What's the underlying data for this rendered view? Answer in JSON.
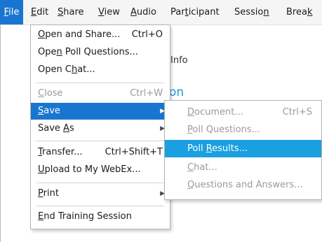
{
  "menubar": {
    "items": [
      {
        "label": "File",
        "mnemonic": "F",
        "rest": "ile",
        "active": true
      },
      {
        "label": "Edit",
        "mnemonic": "E",
        "rest": "dit"
      },
      {
        "label": "Share",
        "mnemonic": "S",
        "rest": "hare"
      },
      {
        "label": "View",
        "mnemonic": "V",
        "rest": "iew"
      },
      {
        "label": "Audio",
        "mnemonic": "A",
        "rest": "udio"
      },
      {
        "label": "Participant",
        "pre": "Par",
        "mnemonic": "t",
        "rest": "icipant"
      },
      {
        "label": "Session",
        "pre": "Sessio",
        "mnemonic": "n",
        "rest": ""
      },
      {
        "label": "Break",
        "pre": "Brea",
        "mnemonic": "k",
        "rest": ""
      }
    ]
  },
  "background": {
    "info_text": "Info",
    "heading_fragment": "on"
  },
  "file_menu": {
    "items": [
      {
        "pre": "",
        "mnemonic": "O",
        "rest": "pen and Share...",
        "shortcut": "Ctrl+O"
      },
      {
        "pre": "Ope",
        "mnemonic": "n",
        "rest": " Poll Questions...",
        "shortcut": ""
      },
      {
        "pre": "Open C",
        "mnemonic": "h",
        "rest": "at...",
        "shortcut": ""
      },
      {
        "pre": "",
        "mnemonic": "C",
        "rest": "lose",
        "shortcut": "Ctrl+W",
        "disabled": true
      },
      {
        "pre": "",
        "mnemonic": "S",
        "rest": "ave",
        "submenu": true,
        "highlighted": true
      },
      {
        "pre": "Save ",
        "mnemonic": "A",
        "rest": "s",
        "submenu": true
      },
      {
        "pre": "",
        "mnemonic": "T",
        "rest": "ransfer...",
        "shortcut": "Ctrl+Shift+T"
      },
      {
        "pre": "",
        "mnemonic": "U",
        "rest": "pload to My WebEx...",
        "shortcut": ""
      },
      {
        "pre": "",
        "mnemonic": "P",
        "rest": "rint",
        "submenu": true
      },
      {
        "pre": "",
        "mnemonic": "E",
        "rest": "nd Training Session",
        "shortcut": ""
      }
    ]
  },
  "save_submenu": {
    "items": [
      {
        "pre": "",
        "mnemonic": "D",
        "rest": "ocument...",
        "shortcut": "Ctrl+S",
        "disabled": true
      },
      {
        "pre": "",
        "mnemonic": "P",
        "rest": "oll Questions...",
        "disabled": true
      },
      {
        "pre": "Poll ",
        "mnemonic": "R",
        "rest": "esults...",
        "highlighted": true
      },
      {
        "pre": "",
        "mnemonic": "C",
        "rest": "hat...",
        "disabled": true
      },
      {
        "pre": "",
        "mnemonic": "Q",
        "rest": "uestions and Answers...",
        "disabled": true
      }
    ]
  },
  "icons": {
    "submenu_arrow": "submenu-arrow-icon"
  },
  "colors": {
    "highlight": "#1a75d1",
    "submenu_highlight": "#1a9fe0",
    "heading": "#1a9ad6",
    "disabled": "#9a9a9a"
  }
}
